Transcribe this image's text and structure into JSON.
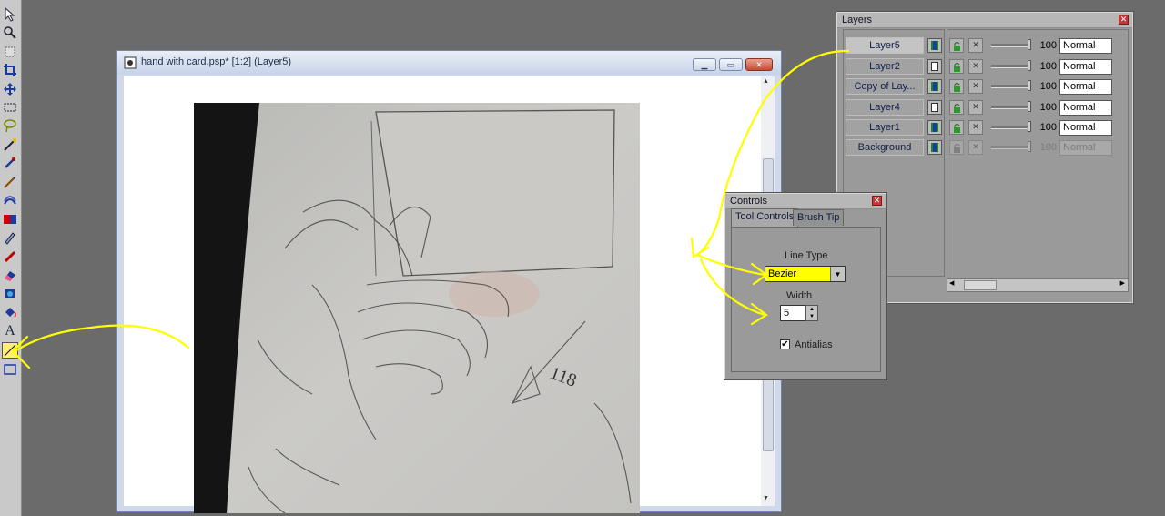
{
  "image_window": {
    "title": "hand with card.psp* [1:2] (Layer5)",
    "buttons": [
      "minimize",
      "maximize",
      "close"
    ]
  },
  "toolbar": {
    "tools": [
      "arrow-icon",
      "zoom-icon",
      "deformation-icon",
      "crop-icon",
      "move-icon",
      "selection-icon",
      "freehand-selection-icon",
      "magic-wand-icon",
      "dropper-icon",
      "paint-brush-icon",
      "clone-brush-icon",
      "color-replacer-icon",
      "retouch-icon",
      "scratch-remover-icon",
      "eraser-icon",
      "picture-tube-icon",
      "airbrush-icon",
      "flood-fill-icon",
      "text-icon",
      "draw-icon",
      "preset-shapes-icon"
    ],
    "text_tool_glyph": "A"
  },
  "layers": {
    "title": "Layers",
    "rows": [
      {
        "name": "Layer5",
        "opacity": "100",
        "blend": "Normal",
        "selected": true,
        "enabled": true
      },
      {
        "name": "Layer2",
        "opacity": "100",
        "blend": "Normal",
        "selected": false,
        "enabled": true
      },
      {
        "name": "Copy of Lay...",
        "opacity": "100",
        "blend": "Normal",
        "selected": false,
        "enabled": true
      },
      {
        "name": "Layer4",
        "opacity": "100",
        "blend": "Normal",
        "selected": false,
        "enabled": true
      },
      {
        "name": "Layer1",
        "opacity": "100",
        "blend": "Normal",
        "selected": false,
        "enabled": true
      },
      {
        "name": "Background",
        "opacity": "100",
        "blend": "Normal",
        "selected": false,
        "enabled": false
      }
    ]
  },
  "controls": {
    "title": "Controls",
    "tabs": [
      "Tool Controls",
      "Brush Tip"
    ],
    "line_type_label": "Line Type",
    "line_type_value": "Bezier",
    "width_label": "Width",
    "width_value": "5",
    "antialias_label": "Antialias",
    "antialias_checked": true
  },
  "sketch_signature": "118",
  "colors": {
    "annotation": "#ffff00",
    "highlight": "#ffff00"
  }
}
